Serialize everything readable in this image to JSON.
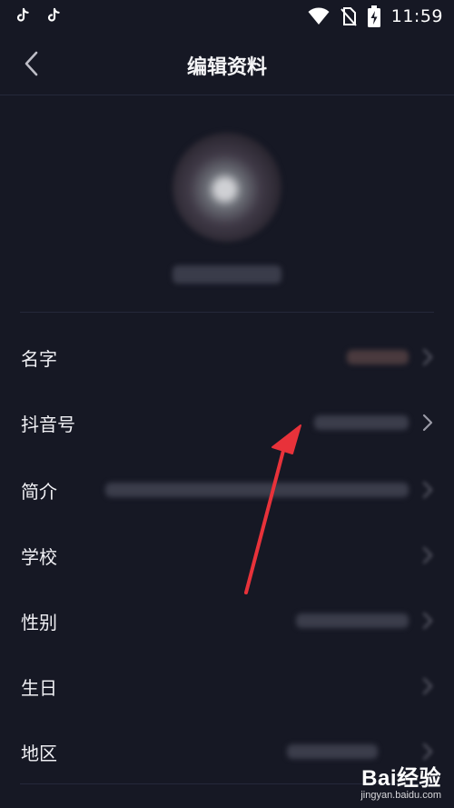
{
  "status_bar": {
    "time": "11:59",
    "icons": [
      "tiktok-app-icon",
      "tiktok-app-icon",
      "wifi-icon",
      "no-sim-icon",
      "battery-charging-icon"
    ]
  },
  "header": {
    "title": "编辑资料",
    "back_icon": "chevron-left-icon"
  },
  "profile": {
    "avatar_state": "blurred",
    "caption_state": "blurred"
  },
  "rows": [
    {
      "label": "名字"
    },
    {
      "label": "抖音号"
    },
    {
      "label": "简介"
    },
    {
      "label": "学校"
    },
    {
      "label": "性别"
    },
    {
      "label": "生日"
    },
    {
      "label": "地区"
    }
  ],
  "annotation": {
    "type": "arrow",
    "color": "#e8323a",
    "target": "抖音号"
  },
  "watermark": {
    "brand": "Bai经验",
    "url": "jingyan.baidu.com"
  },
  "colors": {
    "background": "#161824",
    "divider": "#25283a",
    "text": "#f0f0f4"
  }
}
